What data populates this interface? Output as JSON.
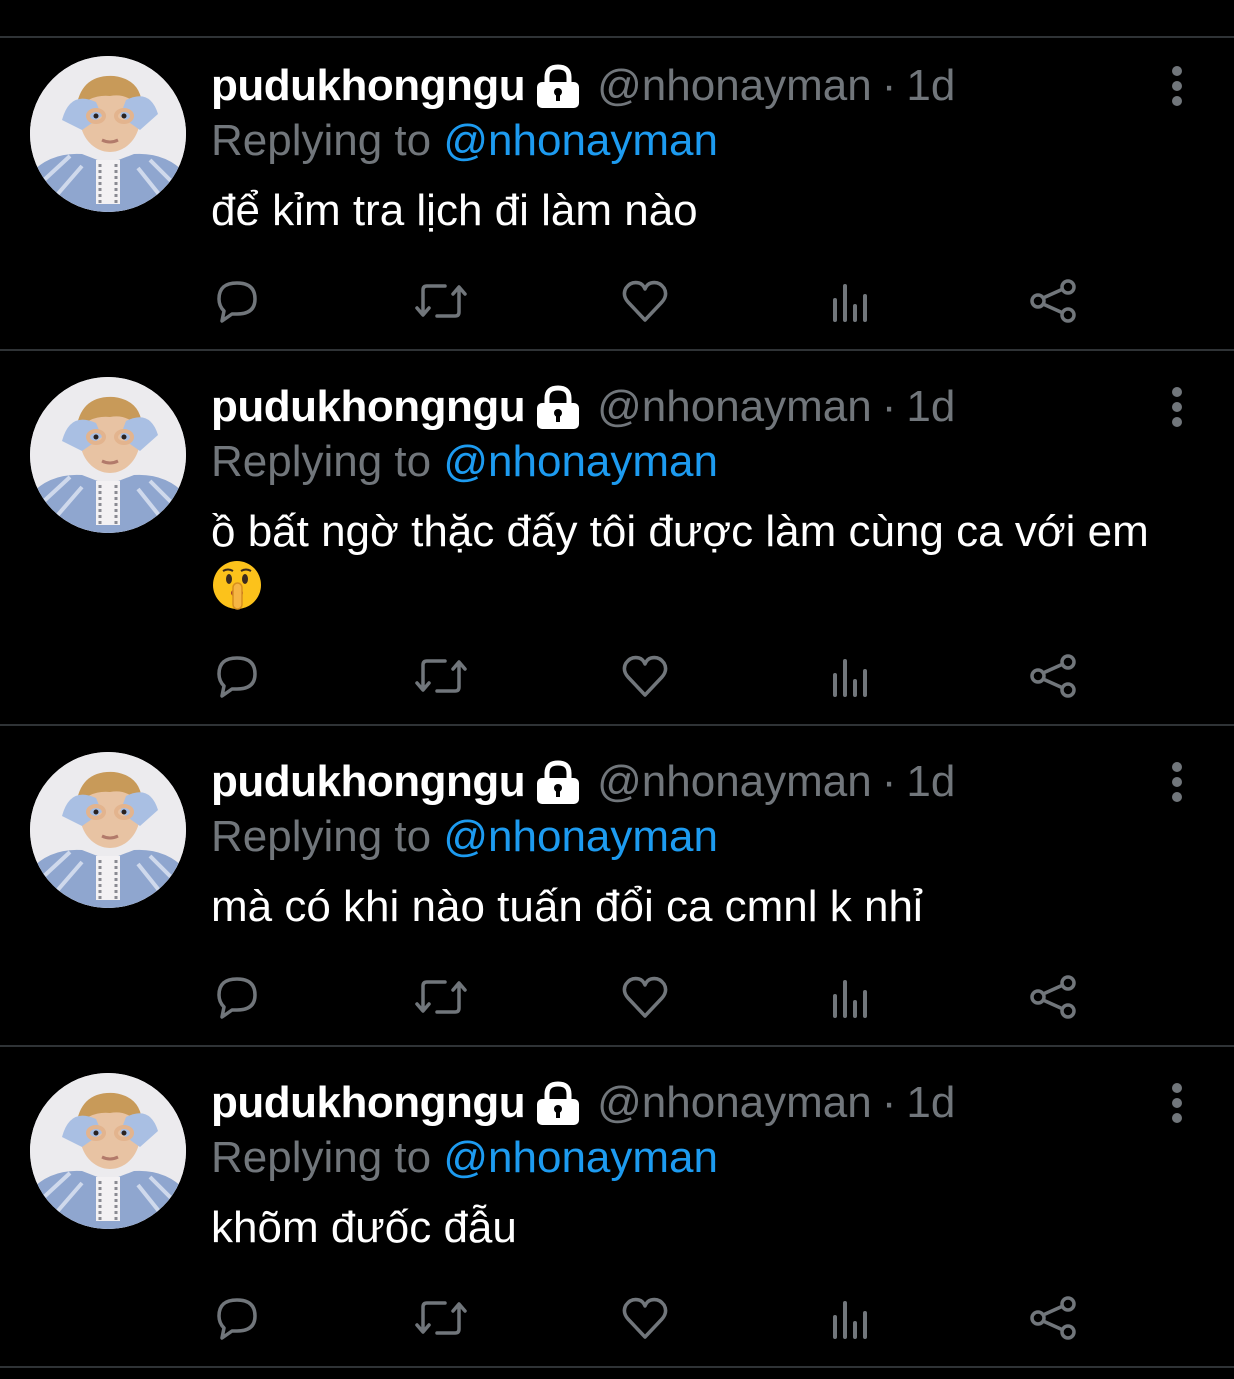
{
  "colors": {
    "background": "#000000",
    "divider": "#2f3336",
    "text_primary": "#ffffff",
    "text_secondary": "#71767b",
    "link": "#1d9bf0"
  },
  "tweets": [
    {
      "display_name": "pudukhongngu",
      "handle": "@nhonayman",
      "separator": "·",
      "time": "1d",
      "reply_prefix": "Replying to",
      "reply_handle": "@nhonayman",
      "text": "để kỉm tra lịch đi làm nào",
      "emoji": ""
    },
    {
      "display_name": "pudukhongngu",
      "handle": "@nhonayman",
      "separator": "·",
      "time": "1d",
      "reply_prefix": "Replying to",
      "reply_handle": "@nhonayman",
      "text": "ồ bất ngờ thặc đấy tôi được làm cùng ca với em",
      "emoji": "shushing-face-emoji"
    },
    {
      "display_name": "pudukhongngu",
      "handle": "@nhonayman",
      "separator": "·",
      "time": "1d",
      "reply_prefix": "Replying to",
      "reply_handle": "@nhonayman",
      "text": "mà có khi nào tuấn đổi ca cmnl k nhỉ",
      "emoji": ""
    },
    {
      "display_name": "pudukhongngu",
      "handle": "@nhonayman",
      "separator": "·",
      "time": "1d",
      "reply_prefix": "Replying to",
      "reply_handle": "@nhonayman",
      "text": "khõm đưốc đẫu",
      "emoji": ""
    }
  ],
  "icons": {
    "lock": "lock-icon",
    "more": "more-vertical-icon",
    "reply": "reply-icon",
    "retweet": "retweet-icon",
    "like": "heart-icon",
    "analytics": "analytics-icon",
    "share": "share-icon"
  }
}
